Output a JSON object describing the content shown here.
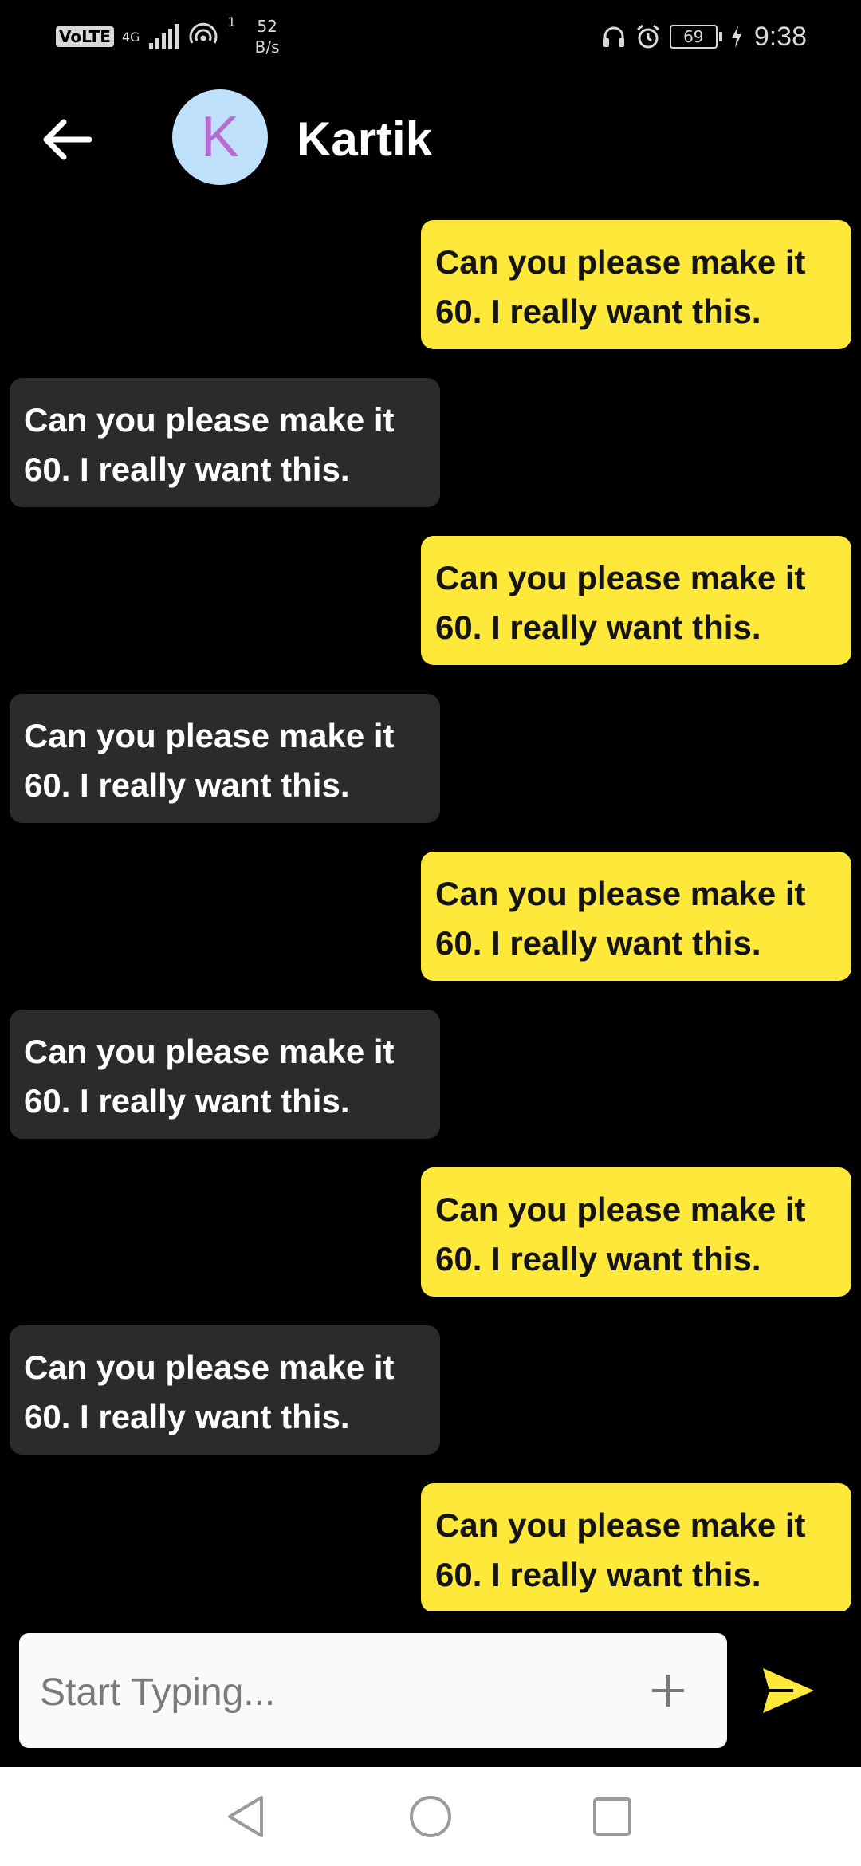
{
  "status_bar": {
    "volte": "VoLTE",
    "network": "4G",
    "hotspot_count": "1",
    "speed_value": "52",
    "speed_unit": "B/s",
    "battery_level": "69",
    "time": "9:38",
    "icons": [
      "headphones-icon",
      "alarm-icon",
      "battery-icon",
      "charging-icon",
      "signal-icon",
      "hotspot-icon"
    ]
  },
  "header": {
    "avatar_initial": "K",
    "contact_name": "Kartik",
    "avatar_color": "#bfe0fb",
    "initial_color": "#b76ad0"
  },
  "messages": [
    {
      "side": "sent",
      "text": "Can you please make it\n60. I really want this."
    },
    {
      "side": "received",
      "text": "Can you please make it\n60. I really want this."
    },
    {
      "side": "sent",
      "text": "Can you please make it\n60. I really want this."
    },
    {
      "side": "received",
      "text": "Can you please make it\n60. I really want this."
    },
    {
      "side": "sent",
      "text": "Can you please make it\n60. I really want this."
    },
    {
      "side": "received",
      "text": "Can you please make it\n60. I really want this."
    },
    {
      "side": "sent",
      "text": "Can you please make it\n60. I really want this."
    },
    {
      "side": "received",
      "text": "Can you please make it\n60. I really want this."
    },
    {
      "side": "sent",
      "text": "Can you please make it\n60. I really want this."
    }
  ],
  "composer": {
    "placeholder": "Start Typing...",
    "value": ""
  },
  "colors": {
    "background": "#000000",
    "sent_bubble": "#fee93b",
    "received_bubble": "#2b2b2b",
    "send_icon": "#fee93b"
  }
}
